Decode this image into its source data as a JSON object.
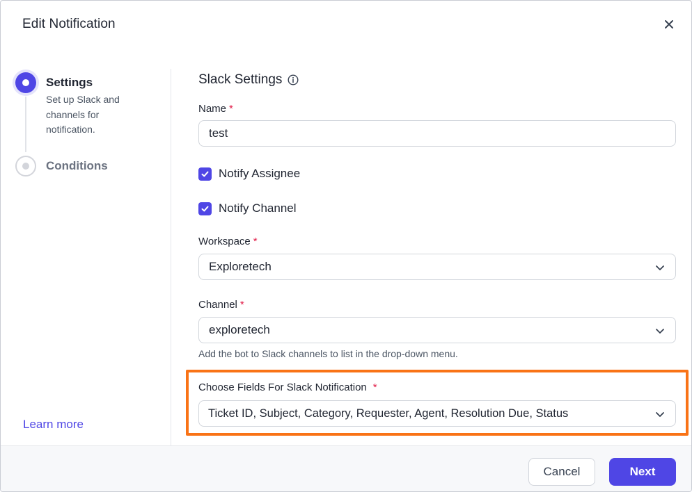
{
  "dialog": {
    "title": "Edit Notification",
    "close_icon": "close-icon"
  },
  "stepper": {
    "steps": [
      {
        "title": "Settings",
        "description": "Set up Slack and channels for notification.",
        "state": "active"
      },
      {
        "title": "Conditions",
        "description": "",
        "state": "inactive"
      }
    ],
    "learn_more": "Learn more"
  },
  "form": {
    "section_title": "Slack Settings",
    "info_icon": "info-icon",
    "name": {
      "label": "Name",
      "required_mark": "*",
      "value": "test"
    },
    "notify_assignee": {
      "label": "Notify Assignee",
      "checked": true
    },
    "notify_channel": {
      "label": "Notify Channel",
      "checked": true
    },
    "workspace": {
      "label": "Workspace",
      "required_mark": "*",
      "value": "Exploretech"
    },
    "channel": {
      "label": "Channel",
      "required_mark": "*",
      "value": "exploretech",
      "hint": "Add the bot to Slack channels to list in the drop-down menu."
    },
    "fields": {
      "label": "Choose Fields For Slack Notification",
      "required_mark": "*",
      "value": "Ticket ID, Subject, Category, Requester, Agent, Resolution Due, Status"
    }
  },
  "footer": {
    "cancel_label": "Cancel",
    "next_label": "Next"
  },
  "colors": {
    "accent": "#4f46e5",
    "highlight": "#f97316",
    "required": "#e11d48"
  }
}
